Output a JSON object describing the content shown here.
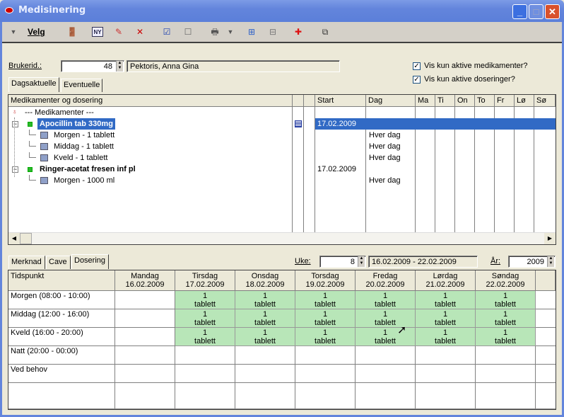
{
  "window": {
    "title": "Medisinering",
    "buttons": [
      "minimize",
      "maximize",
      "close"
    ]
  },
  "toolbar": {
    "menu_label": "Velg",
    "icons": [
      "exit-icon",
      "new-icon",
      "edit-icon",
      "delete-icon",
      "check-all-icon",
      "uncheck-all-icon",
      "print-icon",
      "print-dropdown-icon",
      "expand-tree-icon",
      "collapse-tree-icon",
      "medical-folder-icon",
      "copy-icon"
    ]
  },
  "user": {
    "label": "Brukerid.:",
    "id": "48",
    "name": "Pektoris, Anna Gina"
  },
  "filters": [
    {
      "label": "Vis kun aktive medikamenter?",
      "checked": true
    },
    {
      "label": "Vis kun aktive doseringer?",
      "checked": true
    }
  ],
  "top_tabs": [
    "Dagsaktuelle",
    "Eventuelle"
  ],
  "med_table": {
    "columns": [
      "Medikamenter og dosering",
      "",
      "",
      "Start",
      "Dag",
      "Ma",
      "Ti",
      "On",
      "To",
      "Fr",
      "Lø",
      "Sø"
    ],
    "rows": [
      {
        "name": "--- Medikamenter ---",
        "level": 0,
        "start": "",
        "dag": ""
      },
      {
        "name": "Apocillin tab  330mg",
        "level": 1,
        "bold": true,
        "selected": true,
        "start": "17.02.2009",
        "dag": "",
        "note_icon": true
      },
      {
        "name": "Morgen - 1 tablett",
        "level": 2,
        "start": "",
        "dag": "Hver dag"
      },
      {
        "name": "Middag - 1 tablett",
        "level": 2,
        "start": "",
        "dag": "Hver dag"
      },
      {
        "name": "Kveld - 1 tablett",
        "level": 2,
        "start": "",
        "dag": "Hver dag"
      },
      {
        "name": "Ringer-acetat fresen inf pl",
        "level": 1,
        "bold": true,
        "start": "17.02.2009",
        "dag": ""
      },
      {
        "name": "Morgen - 1000 ml",
        "level": 2,
        "start": "",
        "dag": "Hver dag"
      }
    ]
  },
  "bottom_tabs": [
    "Merknad",
    "Cave",
    "Dosering"
  ],
  "week": {
    "label": "Uke:",
    "value": "8",
    "range": "16.02.2009 - 22.02.2009",
    "year_label": "År:",
    "year": "2009"
  },
  "schedule": {
    "first_header": "Tidspunkt",
    "days": [
      {
        "name": "Mandag",
        "date": "16.02.2009"
      },
      {
        "name": "Tirsdag",
        "date": "17.02.2009"
      },
      {
        "name": "Onsdag",
        "date": "18.02.2009"
      },
      {
        "name": "Torsdag",
        "date": "19.02.2009"
      },
      {
        "name": "Fredag",
        "date": "20.02.2009"
      },
      {
        "name": "Lørdag",
        "date": "21.02.2009"
      },
      {
        "name": "Søndag",
        "date": "22.02.2009"
      }
    ],
    "rows": [
      {
        "label": "Morgen (08:00 - 10:00)",
        "doses": [
          "",
          "1 tablett",
          "1 tablett",
          "1 tablett",
          "1 tablett",
          "1 tablett",
          "1 tablett"
        ]
      },
      {
        "label": "Middag (12:00 - 16:00)",
        "doses": [
          "",
          "1 tablett",
          "1 tablett",
          "1 tablett",
          "1 tablett",
          "1 tablett",
          "1 tablett"
        ]
      },
      {
        "label": "Kveld (16:00 - 20:00)",
        "doses": [
          "",
          "1 tablett",
          "1 tablett",
          "1 tablett",
          "1 tablett",
          "1 tablett",
          "1 tablett"
        ]
      },
      {
        "label": "Natt (20:00 - 00:00)",
        "doses": [
          "",
          "",
          "",
          "",
          "",
          "",
          ""
        ]
      },
      {
        "label": "Ved behov",
        "doses": [
          "",
          "",
          "",
          "",
          "",
          "",
          ""
        ]
      },
      {
        "label": "",
        "doses": [
          "",
          "",
          "",
          "",
          "",
          "",
          ""
        ]
      }
    ],
    "dose_color": "#b8e6b8"
  }
}
